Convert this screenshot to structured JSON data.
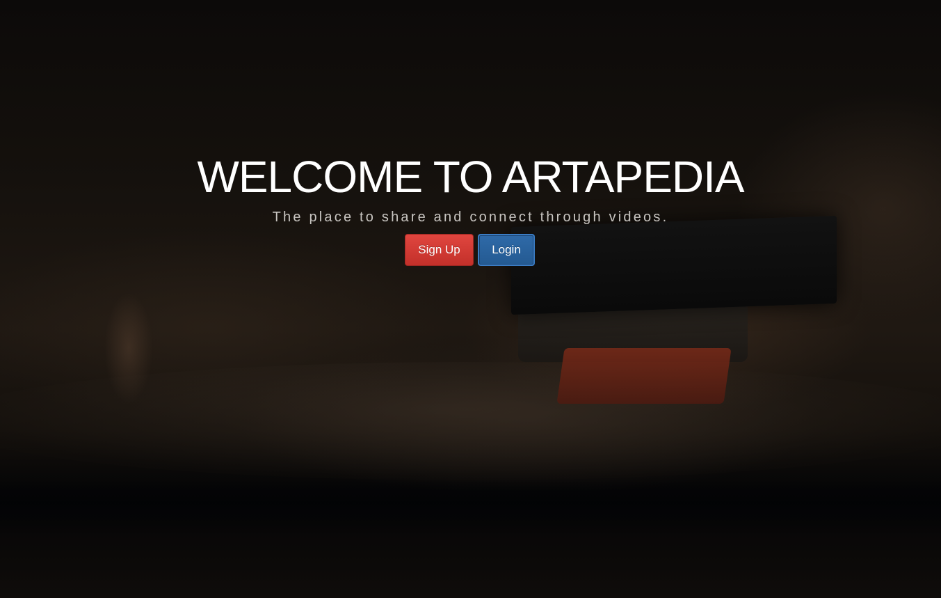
{
  "hero": {
    "title": "WELCOME TO ARTAPEDIA",
    "subtitle": "The place to share and connect through videos.",
    "signup_label": "Sign Up",
    "login_label": "Login"
  },
  "colors": {
    "signup_button": "#d33a34",
    "login_button": "#2a62a0",
    "title_text": "#ffffff",
    "subtitle_text": "#c9c6c2"
  }
}
